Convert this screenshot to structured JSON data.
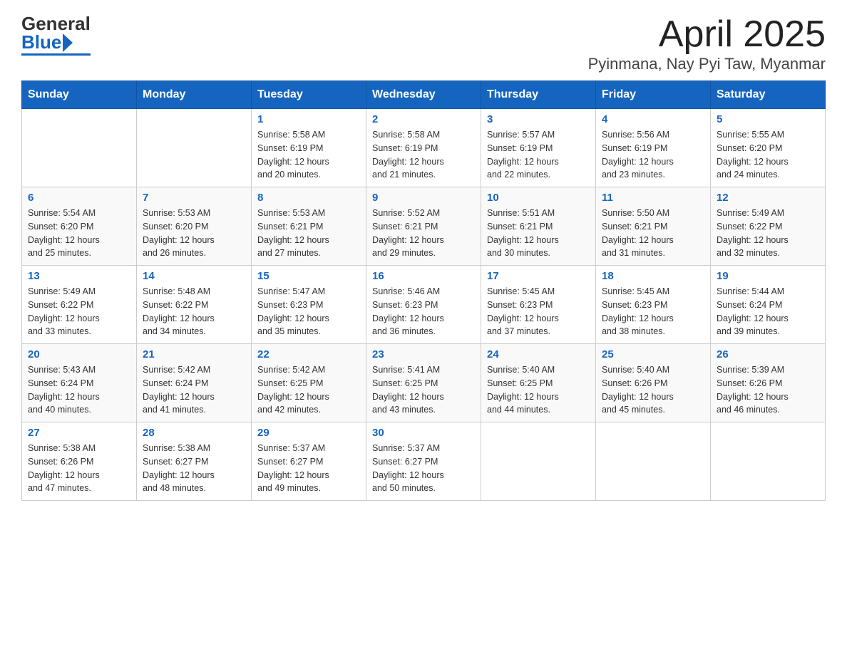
{
  "header": {
    "title": "April 2025",
    "subtitle": "Pyinmana, Nay Pyi Taw, Myanmar",
    "logo_general": "General",
    "logo_blue": "Blue"
  },
  "columns": [
    "Sunday",
    "Monday",
    "Tuesday",
    "Wednesday",
    "Thursday",
    "Friday",
    "Saturday"
  ],
  "weeks": [
    [
      {
        "day": "",
        "info": ""
      },
      {
        "day": "",
        "info": ""
      },
      {
        "day": "1",
        "info": "Sunrise: 5:58 AM\nSunset: 6:19 PM\nDaylight: 12 hours\nand 20 minutes."
      },
      {
        "day": "2",
        "info": "Sunrise: 5:58 AM\nSunset: 6:19 PM\nDaylight: 12 hours\nand 21 minutes."
      },
      {
        "day": "3",
        "info": "Sunrise: 5:57 AM\nSunset: 6:19 PM\nDaylight: 12 hours\nand 22 minutes."
      },
      {
        "day": "4",
        "info": "Sunrise: 5:56 AM\nSunset: 6:19 PM\nDaylight: 12 hours\nand 23 minutes."
      },
      {
        "day": "5",
        "info": "Sunrise: 5:55 AM\nSunset: 6:20 PM\nDaylight: 12 hours\nand 24 minutes."
      }
    ],
    [
      {
        "day": "6",
        "info": "Sunrise: 5:54 AM\nSunset: 6:20 PM\nDaylight: 12 hours\nand 25 minutes."
      },
      {
        "day": "7",
        "info": "Sunrise: 5:53 AM\nSunset: 6:20 PM\nDaylight: 12 hours\nand 26 minutes."
      },
      {
        "day": "8",
        "info": "Sunrise: 5:53 AM\nSunset: 6:21 PM\nDaylight: 12 hours\nand 27 minutes."
      },
      {
        "day": "9",
        "info": "Sunrise: 5:52 AM\nSunset: 6:21 PM\nDaylight: 12 hours\nand 29 minutes."
      },
      {
        "day": "10",
        "info": "Sunrise: 5:51 AM\nSunset: 6:21 PM\nDaylight: 12 hours\nand 30 minutes."
      },
      {
        "day": "11",
        "info": "Sunrise: 5:50 AM\nSunset: 6:21 PM\nDaylight: 12 hours\nand 31 minutes."
      },
      {
        "day": "12",
        "info": "Sunrise: 5:49 AM\nSunset: 6:22 PM\nDaylight: 12 hours\nand 32 minutes."
      }
    ],
    [
      {
        "day": "13",
        "info": "Sunrise: 5:49 AM\nSunset: 6:22 PM\nDaylight: 12 hours\nand 33 minutes."
      },
      {
        "day": "14",
        "info": "Sunrise: 5:48 AM\nSunset: 6:22 PM\nDaylight: 12 hours\nand 34 minutes."
      },
      {
        "day": "15",
        "info": "Sunrise: 5:47 AM\nSunset: 6:23 PM\nDaylight: 12 hours\nand 35 minutes."
      },
      {
        "day": "16",
        "info": "Sunrise: 5:46 AM\nSunset: 6:23 PM\nDaylight: 12 hours\nand 36 minutes."
      },
      {
        "day": "17",
        "info": "Sunrise: 5:45 AM\nSunset: 6:23 PM\nDaylight: 12 hours\nand 37 minutes."
      },
      {
        "day": "18",
        "info": "Sunrise: 5:45 AM\nSunset: 6:23 PM\nDaylight: 12 hours\nand 38 minutes."
      },
      {
        "day": "19",
        "info": "Sunrise: 5:44 AM\nSunset: 6:24 PM\nDaylight: 12 hours\nand 39 minutes."
      }
    ],
    [
      {
        "day": "20",
        "info": "Sunrise: 5:43 AM\nSunset: 6:24 PM\nDaylight: 12 hours\nand 40 minutes."
      },
      {
        "day": "21",
        "info": "Sunrise: 5:42 AM\nSunset: 6:24 PM\nDaylight: 12 hours\nand 41 minutes."
      },
      {
        "day": "22",
        "info": "Sunrise: 5:42 AM\nSunset: 6:25 PM\nDaylight: 12 hours\nand 42 minutes."
      },
      {
        "day": "23",
        "info": "Sunrise: 5:41 AM\nSunset: 6:25 PM\nDaylight: 12 hours\nand 43 minutes."
      },
      {
        "day": "24",
        "info": "Sunrise: 5:40 AM\nSunset: 6:25 PM\nDaylight: 12 hours\nand 44 minutes."
      },
      {
        "day": "25",
        "info": "Sunrise: 5:40 AM\nSunset: 6:26 PM\nDaylight: 12 hours\nand 45 minutes."
      },
      {
        "day": "26",
        "info": "Sunrise: 5:39 AM\nSunset: 6:26 PM\nDaylight: 12 hours\nand 46 minutes."
      }
    ],
    [
      {
        "day": "27",
        "info": "Sunrise: 5:38 AM\nSunset: 6:26 PM\nDaylight: 12 hours\nand 47 minutes."
      },
      {
        "day": "28",
        "info": "Sunrise: 5:38 AM\nSunset: 6:27 PM\nDaylight: 12 hours\nand 48 minutes."
      },
      {
        "day": "29",
        "info": "Sunrise: 5:37 AM\nSunset: 6:27 PM\nDaylight: 12 hours\nand 49 minutes."
      },
      {
        "day": "30",
        "info": "Sunrise: 5:37 AM\nSunset: 6:27 PM\nDaylight: 12 hours\nand 50 minutes."
      },
      {
        "day": "",
        "info": ""
      },
      {
        "day": "",
        "info": ""
      },
      {
        "day": "",
        "info": ""
      }
    ]
  ]
}
